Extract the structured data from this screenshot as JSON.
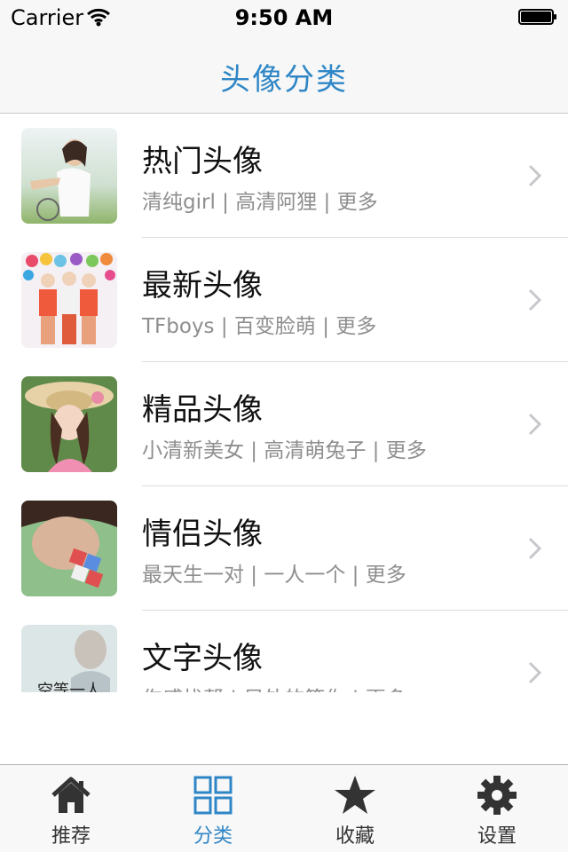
{
  "status_bar": {
    "carrier": "Carrier",
    "time": "9:50 AM"
  },
  "nav": {
    "title": "头像分类"
  },
  "accent_color": "#2f86c6",
  "categories": [
    {
      "title": "热门头像",
      "subtitle": "清纯girl | 高清阿狸 | 更多"
    },
    {
      "title": "最新头像",
      "subtitle": "TFboys | 百变脸萌 | 更多"
    },
    {
      "title": "精品头像",
      "subtitle": "小清新美女 | 高清萌兔子 | 更多"
    },
    {
      "title": "情侣头像",
      "subtitle": "最天生一对 | 一人一个 | 更多"
    },
    {
      "title": "文字头像",
      "subtitle": "伤感找帮 | 另外的等你 | 更多",
      "thumb_text": "空等一人"
    }
  ],
  "tabs": [
    {
      "label": "推荐",
      "icon": "home-icon"
    },
    {
      "label": "分类",
      "icon": "grid-icon",
      "active": true
    },
    {
      "label": "收藏",
      "icon": "star-icon"
    },
    {
      "label": "设置",
      "icon": "gear-icon"
    }
  ]
}
